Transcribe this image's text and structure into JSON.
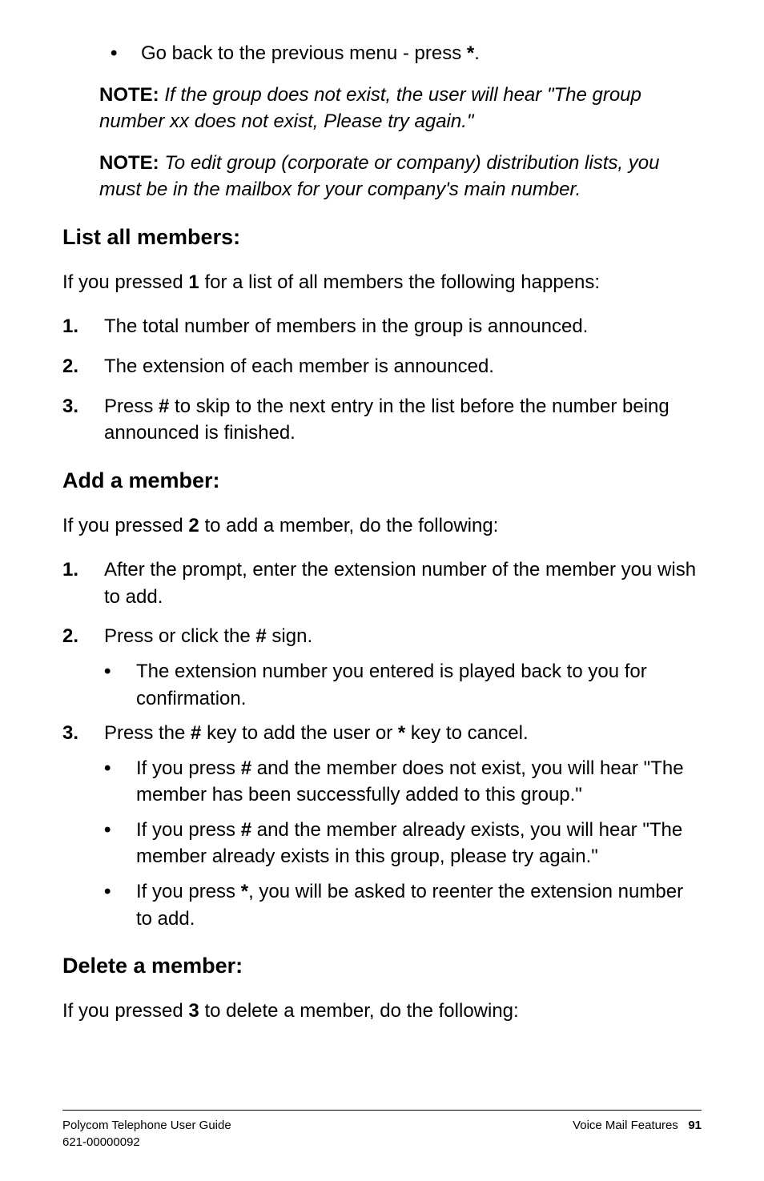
{
  "topBullet": {
    "pre": "Go back to the previous menu - press ",
    "key": "*",
    "post": "."
  },
  "note1": {
    "label": "NOTE:",
    "text": " If the group does not exist, the user will hear \"The group number xx does not exist, Please try again.\""
  },
  "note2": {
    "label": "NOTE:",
    "text": " To edit group (corporate or company) distribution lists, you must be in the mailbox for your company's main number."
  },
  "section1": {
    "heading": "List all members:",
    "intro_pre": "If you pressed ",
    "intro_key": "1",
    "intro_post": " for a list of all members the following happens:",
    "items": [
      {
        "num": "1.",
        "text": "The total number of members in the group is announced."
      },
      {
        "num": "2.",
        "text": "The extension of each member is announced."
      },
      {
        "num": "3.",
        "pre": "Press ",
        "key": "#",
        "post": " to skip to the next entry in the list before the number being announced is finished."
      }
    ]
  },
  "section2": {
    "heading": "Add a member:",
    "intro_pre": "If you pressed ",
    "intro_key": "2",
    "intro_post": " to add a member, do the following:",
    "item1": {
      "num": "1.",
      "text": "After the prompt, enter the extension number of the member you wish to add."
    },
    "item2": {
      "num": "2.",
      "pre": "Press or click the ",
      "key": "#",
      "post": " sign."
    },
    "item2_sub": "The extension number you entered is played back to you for confirmation.",
    "item3": {
      "num": "3.",
      "pre": "Press the ",
      "key1": "#",
      "mid": " key to add the user or ",
      "key2": "*",
      "post": " key to cancel."
    },
    "item3_sub1": {
      "pre": "If you press ",
      "key": "#",
      "post": " and the member does not exist, you will hear \"The member has been successfully added to this group.\""
    },
    "item3_sub2": {
      "pre": "If you press ",
      "key": "#",
      "post": " and the member already exists, you will hear \"The member already exists in this group, please try again.\""
    },
    "item3_sub3": {
      "pre": " If you press ",
      "key": "*",
      "post": ", you will be asked to reenter the extension number to add."
    }
  },
  "section3": {
    "heading": "Delete a member:",
    "intro_pre": "If you pressed ",
    "intro_key": "3",
    "intro_post": " to delete a member, do the following:"
  },
  "footer": {
    "left1": "Polycom Telephone User Guide",
    "left2": "621-00000092",
    "right_label": "Voice Mail Features",
    "page": "91"
  }
}
